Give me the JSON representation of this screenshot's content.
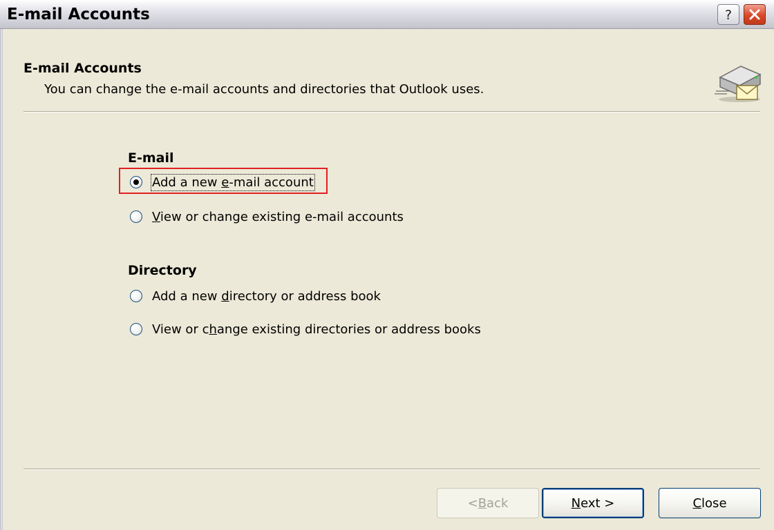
{
  "window": {
    "title": "E-mail Accounts"
  },
  "header": {
    "title": "E-mail Accounts",
    "description": "You can change the e-mail accounts and directories that Outlook uses.",
    "icon": "mail-server-icon"
  },
  "groups": [
    {
      "label": "E-mail",
      "options": [
        {
          "pre": "Add a new ",
          "ul": "e",
          "post": "-mail account",
          "checked": true
        },
        {
          "pre": "",
          "ul": "V",
          "post": "iew or change existing e-mail accounts",
          "checked": false
        }
      ]
    },
    {
      "label": "Directory",
      "options": [
        {
          "pre": "Add a new ",
          "ul": "d",
          "post": "irectory or address book",
          "checked": false
        },
        {
          "pre": "View or c",
          "ul": "h",
          "post": "ange existing directories or address books",
          "checked": false
        }
      ]
    }
  ],
  "buttons": {
    "back": {
      "pre": "< ",
      "ul": "B",
      "post": "ack",
      "enabled": false
    },
    "next": {
      "pre": "",
      "ul": "N",
      "post": "ext >",
      "enabled": true
    },
    "close": {
      "pre": "",
      "ul": "C",
      "post": "lose",
      "enabled": true
    }
  },
  "colors": {
    "dialog_bg": "#ece9d8",
    "highlight_border": "#e02020",
    "button_border": "#003c74"
  }
}
